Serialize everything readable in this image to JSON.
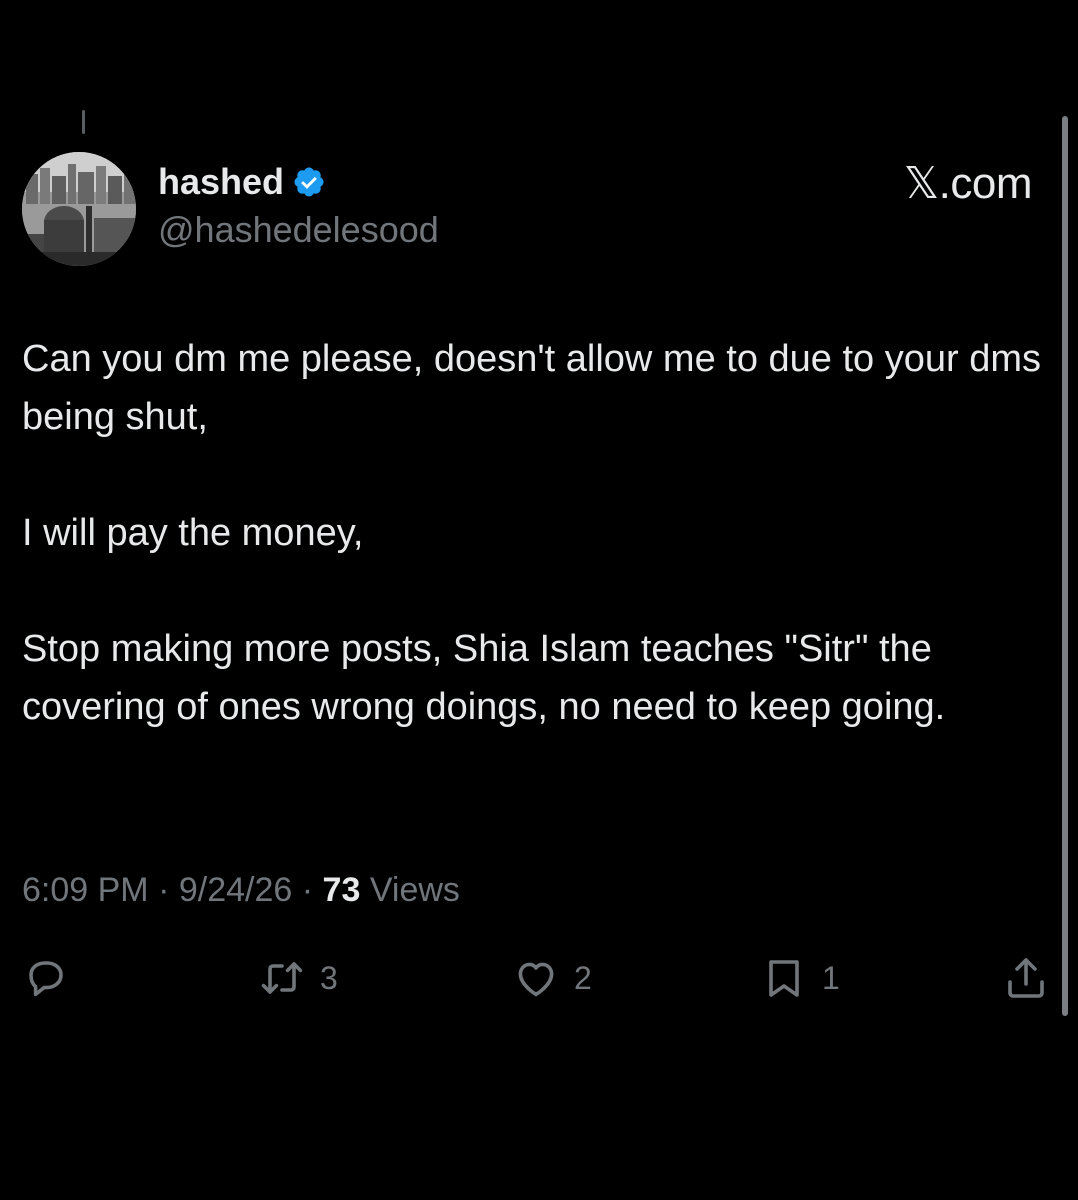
{
  "author": {
    "display_name": "hashed",
    "handle": "@hashedelesood",
    "verified": true,
    "avatar_icon": "avatar-photo-cityscape-mosque"
  },
  "watermark": {
    "site": "𝕏.com"
  },
  "post": {
    "paragraphs": [
      "Can you dm me please, doesn't allow me to due to your dms being shut,",
      "I will pay the money,",
      "Stop making more posts, Shia Islam teaches \"Sitr\" the covering of ones wrong doings, no need to keep going."
    ]
  },
  "meta": {
    "time": "6:09 PM",
    "separator": "·",
    "date": "9/24/26",
    "views_count": "73",
    "views_label": "Views"
  },
  "actions": {
    "reply": {
      "icon": "reply-icon",
      "count": ""
    },
    "repost": {
      "icon": "repost-icon",
      "count": "3"
    },
    "like": {
      "icon": "heart-icon",
      "count": "2"
    },
    "bookmark": {
      "icon": "bookmark-icon",
      "count": "1"
    },
    "share": {
      "icon": "share-icon"
    }
  },
  "colors": {
    "background": "#000000",
    "primary_text": "#e7e9ea",
    "secondary_text": "#71767b",
    "verified_badge": "#1d9bf0"
  }
}
